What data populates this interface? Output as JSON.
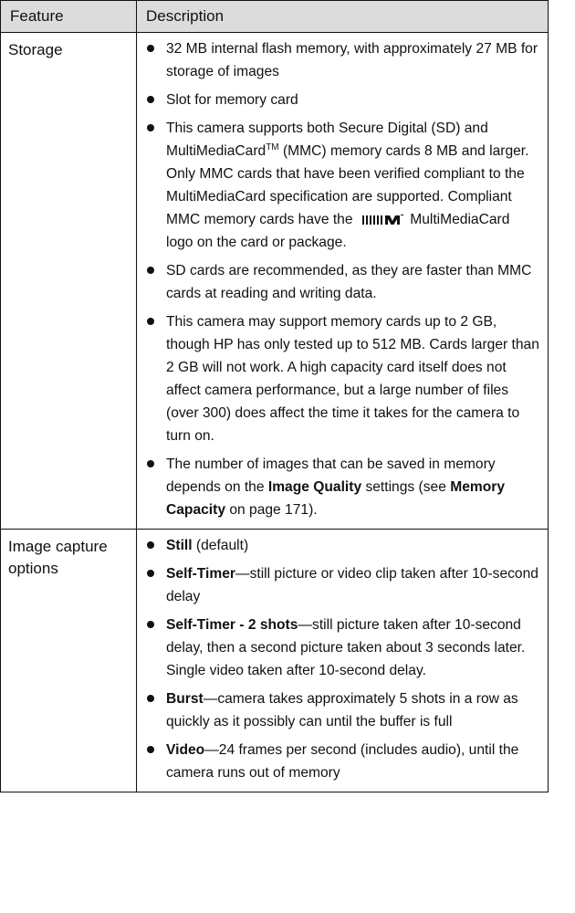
{
  "table": {
    "header_feature": "Feature",
    "header_description": "Description"
  },
  "storage": {
    "feature": "Storage",
    "items": [
      "32 MB internal flash memory, with approximately 27 MB for storage of images",
      "Slot for memory card"
    ],
    "card_item": {
      "part1": "This camera supports both Secure Digital (SD) and MultiMediaCard",
      "tm": "TM",
      "part2": " (MMC) memory cards 8 MB and larger. Only MMC cards that have been verified compliant to the MultiMediaCard specification are supported. Compliant MMC memory cards have the",
      "logo_name": "multimediacard-logo",
      "part3": "MultiMediaCard logo on the card or package."
    },
    "items2": [
      "SD cards are recommended, as they are faster than MMC cards at reading and writing data.",
      "This camera may support memory cards up to 2 GB, though HP has only tested up to 512 MB. Cards larger than 2 GB will not work. A high capacity card itself does not affect camera performance, but a large number of files (over 300) does affect the time it takes for the camera to turn on."
    ],
    "quality_item": {
      "part1": "The number of images that can be saved in memory depends on the ",
      "bold1": "Image Quality",
      "part2": " settings (see ",
      "bold2": "Memory Capacity",
      "part3": " on page 171)."
    }
  },
  "capture": {
    "feature": "Image capture options",
    "still": {
      "bold": "Still",
      "rest": " (default)"
    },
    "self_timer": {
      "bold": "Self-Timer",
      "rest": "—still picture or video clip taken after 10-second delay"
    },
    "self_timer_2": {
      "bold": "Self-Timer - 2 shots",
      "rest": "—still picture taken after 10-second delay, then a second picture taken about 3 seconds later.",
      "extra": "Single video taken after 10-second delay."
    },
    "burst": {
      "bold": "Burst",
      "rest": "—camera takes approximately 5 shots in a row as quickly as it possibly can until the buffer is full"
    },
    "video": {
      "bold": "Video",
      "rest": "—24 frames per second (includes audio), until the camera runs out of memory"
    }
  }
}
